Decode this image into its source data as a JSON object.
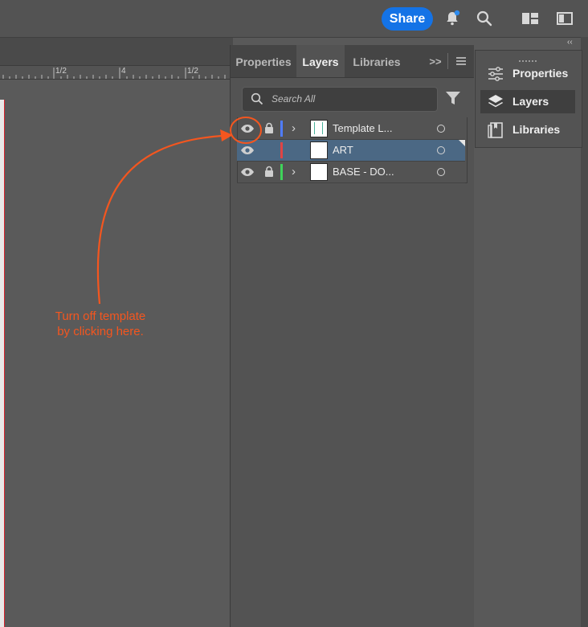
{
  "topbar": {
    "share_label": "Share",
    "icons": [
      "bell-icon",
      "search-icon",
      "arrange-icon",
      "panel-toggle-icon"
    ]
  },
  "ruler": {
    "labels": [
      "1/2",
      "4",
      "1/2"
    ]
  },
  "annotation": {
    "line1": "Turn off template",
    "line2": "by clicking here.",
    "color": "#f4561f"
  },
  "layers_panel": {
    "tabs": [
      {
        "label": "Properties",
        "active": false
      },
      {
        "label": "Layers",
        "active": true
      },
      {
        "label": "Libraries",
        "active": false
      }
    ],
    "overflow_label": ">>",
    "search_placeholder": "Search All",
    "layers": [
      {
        "name": "Template L...",
        "visible": true,
        "locked": true,
        "color": "#4f7cff",
        "expandable": true,
        "selected": false
      },
      {
        "name": "ART",
        "visible": true,
        "locked": false,
        "color": "#e04545",
        "expandable": false,
        "selected": true
      },
      {
        "name": "BASE - DO...",
        "visible": true,
        "locked": true,
        "color": "#3fd35a",
        "expandable": true,
        "selected": false
      }
    ]
  },
  "right_dock": {
    "collapse_label": "‹‹",
    "items": [
      {
        "label": "Properties",
        "icon": "sliders-icon",
        "active": false
      },
      {
        "label": "Layers",
        "icon": "layers-icon",
        "active": true
      },
      {
        "label": "Libraries",
        "icon": "libraries-icon",
        "active": false
      }
    ]
  },
  "colors": {
    "accent": "#1473e6",
    "selection": "#4b6884"
  }
}
